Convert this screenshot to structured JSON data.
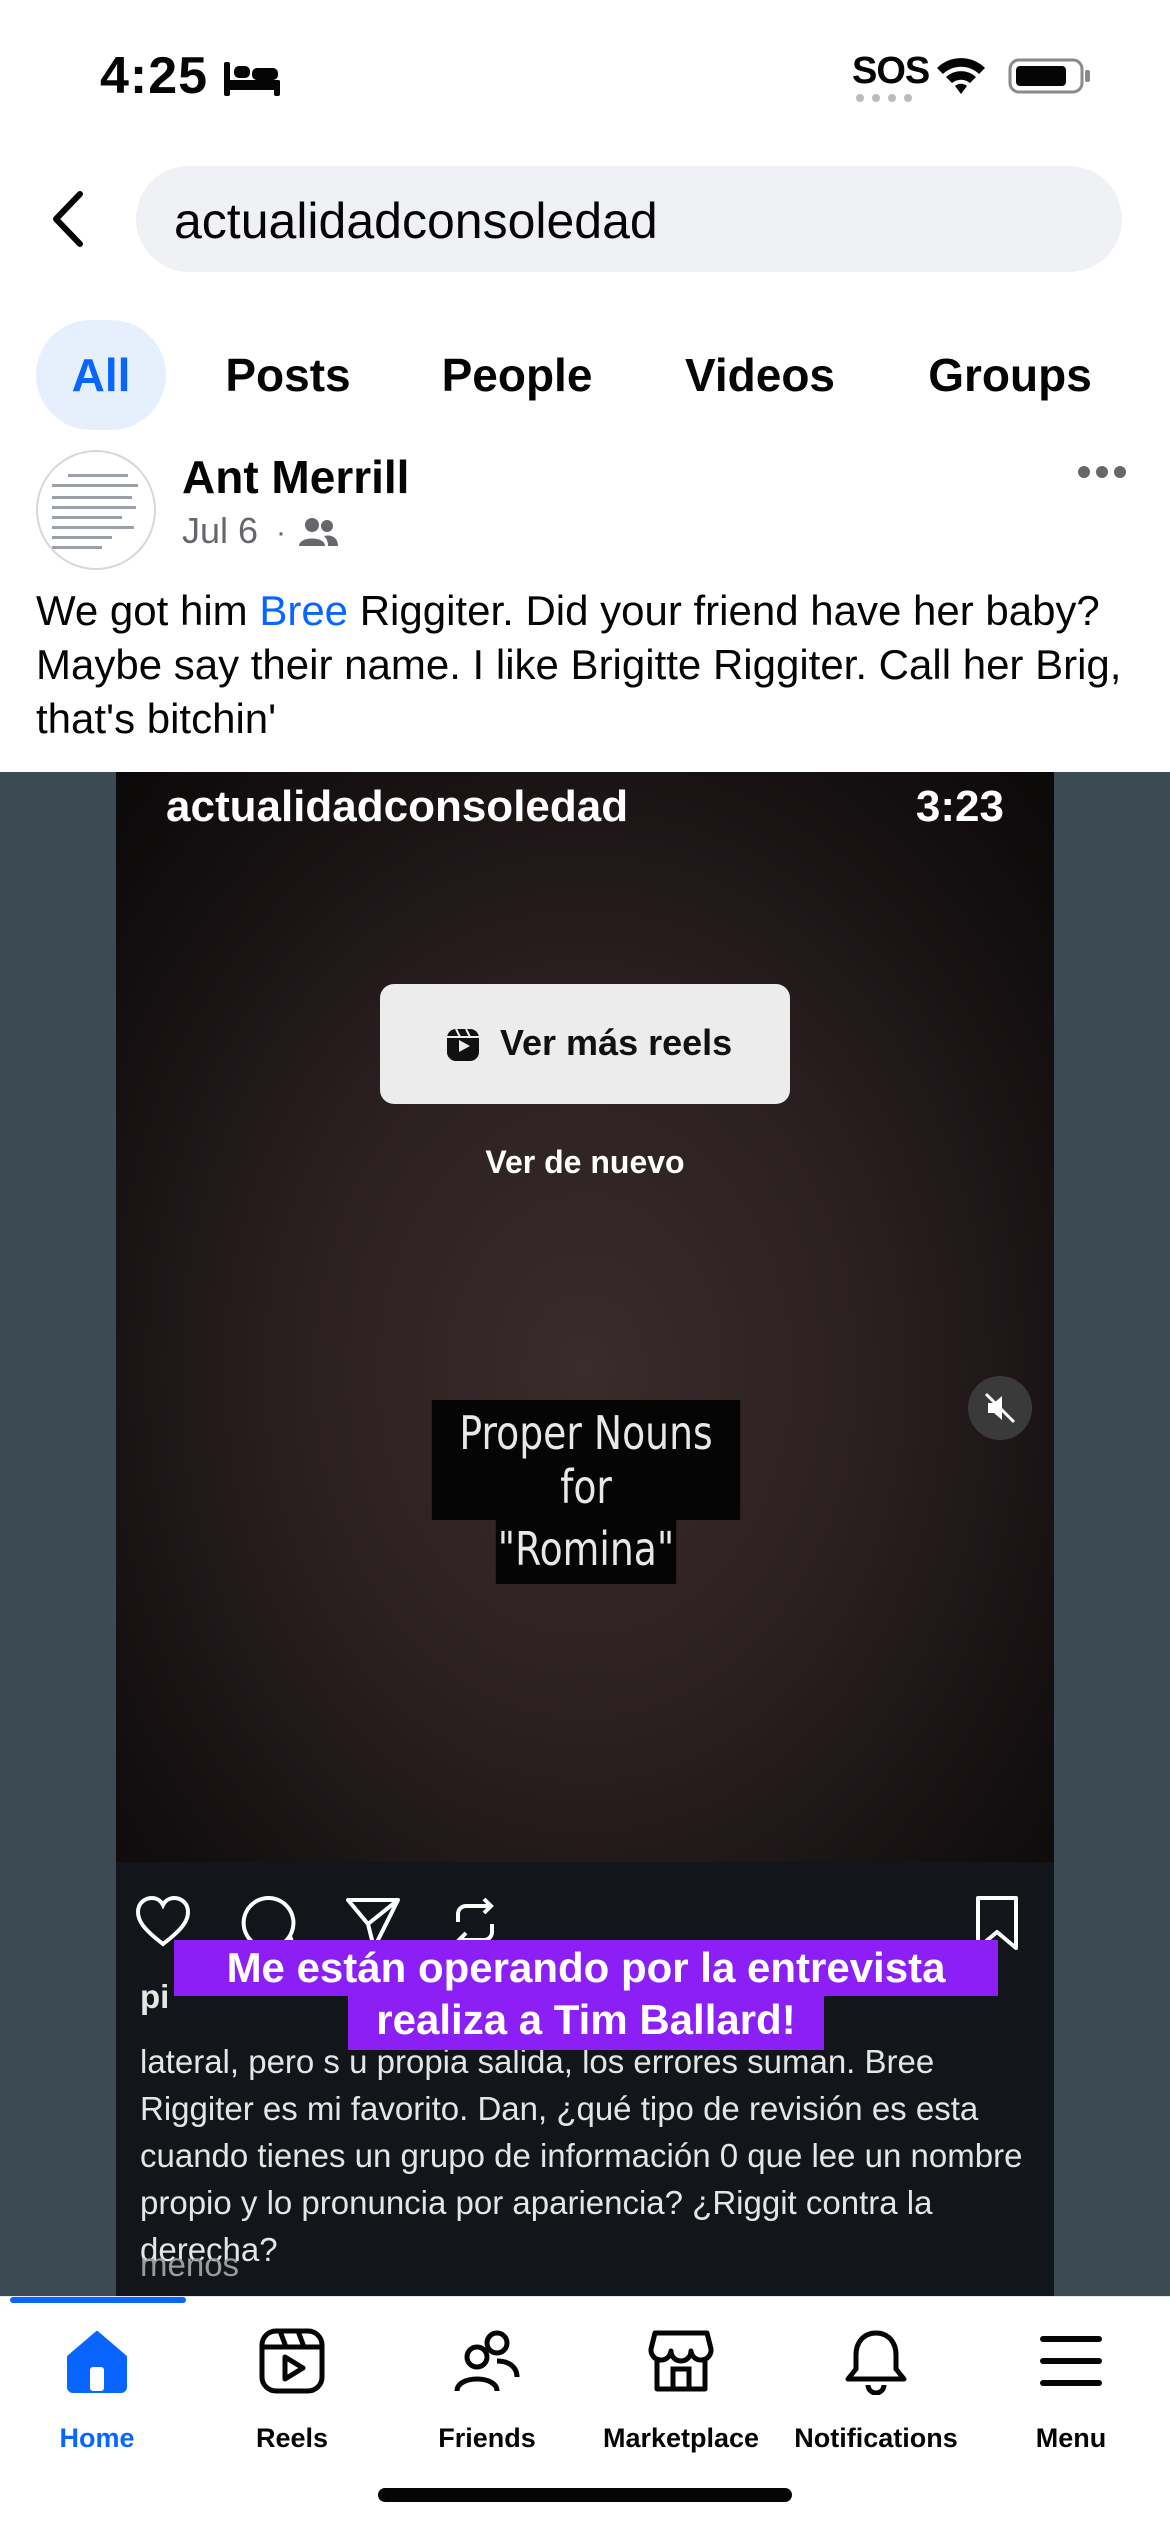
{
  "status_bar": {
    "time": "4:25",
    "sos": "SOS",
    "icons": [
      "bed-icon",
      "wifi-icon",
      "battery-icon"
    ]
  },
  "search": {
    "query": "actualidadconsoledad"
  },
  "tabs": [
    {
      "label": "All",
      "active": true
    },
    {
      "label": "Posts",
      "active": false
    },
    {
      "label": "People",
      "active": false
    },
    {
      "label": "Videos",
      "active": false
    },
    {
      "label": "Groups",
      "active": false
    }
  ],
  "post": {
    "author": "Ant Merrill",
    "date": "Jul 6",
    "separator": "·",
    "audience_icon": "friends-icon",
    "text_before_mention": "We got him ",
    "mention": "Bree",
    "text_after_mention": " Riggiter. Did your friend have her baby? Maybe say their name. I like Brigitte Riggiter. Call her Brig, that's bitchin'"
  },
  "video": {
    "account": "actualidadconsoledad",
    "duration": "3:23",
    "more_reels_label": "Ver más reels",
    "watch_again_label": "Ver de nuevo",
    "overlay_caption_line1": "Proper Nouns for",
    "overlay_caption_line2": "\"Romina\"",
    "mute_icon": "mute-icon",
    "ig_icons": [
      "heart-icon",
      "comment-icon",
      "share-icon",
      "repost-icon",
      "bookmark-icon"
    ],
    "ig_caption_start": "pi",
    "ig_caption": "lateral, pero s                                u propia salida, los errores suman. Bree Riggiter es mi favorito. Dan, ¿qué tipo de revisión es esta cuando tienes un grupo de información 0 que lee un nombre propio y lo pronuncia por apariencia? ¿Riggit contra la derecha?",
    "ig_less": "menos",
    "banner_line1": "Me están operando por la entrevista",
    "banner_line2": "realiza a Tim Ballard!"
  },
  "bottom_nav": [
    {
      "label": "Home",
      "icon": "home-icon",
      "active": true
    },
    {
      "label": "Reels",
      "icon": "reels-icon",
      "active": false
    },
    {
      "label": "Friends",
      "icon": "friends-nav-icon",
      "active": false
    },
    {
      "label": "Marketplace",
      "icon": "marketplace-icon",
      "active": false
    },
    {
      "label": "Notifications",
      "icon": "bell-icon",
      "active": false
    },
    {
      "label": "Menu",
      "icon": "menu-icon",
      "active": false
    }
  ],
  "colors": {
    "accent": "#0866ff",
    "search_bg": "#eff1f4",
    "video_bg": "#3c4a53",
    "banner": "#8b1ff5"
  }
}
